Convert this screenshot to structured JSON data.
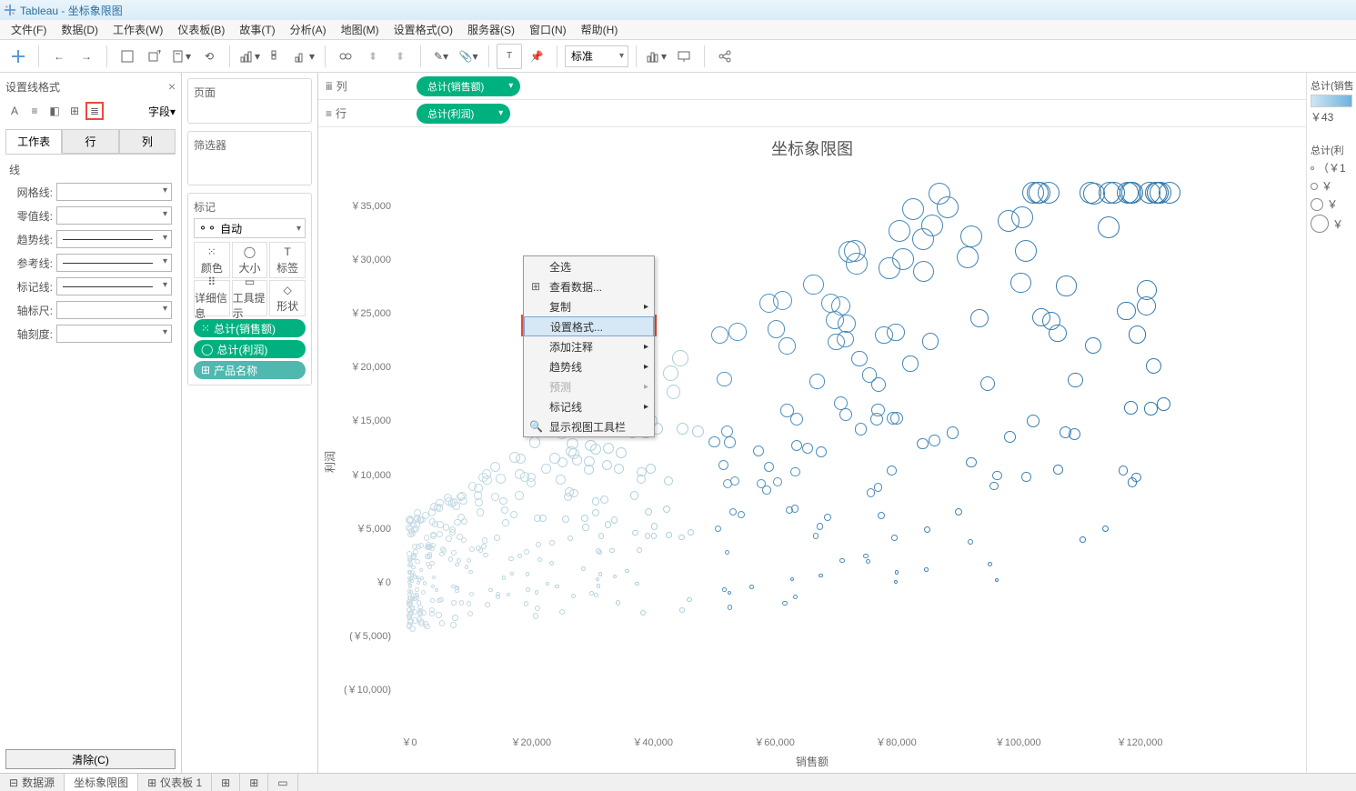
{
  "window_title": "Tableau - 坐标象限图",
  "menu": [
    "文件(F)",
    "数据(D)",
    "工作表(W)",
    "仪表板(B)",
    "故事(T)",
    "分析(A)",
    "地图(M)",
    "设置格式(O)",
    "服务器(S)",
    "窗口(N)",
    "帮助(H)"
  ],
  "toolbar_fit": "标准",
  "format_pane": {
    "title": "设置线格式",
    "fields_label": "字段",
    "tabs": [
      "工作表",
      "行",
      "列"
    ],
    "active_tab": 0,
    "section_label": "线",
    "rows": {
      "grid": "网格线:",
      "zero": "零值线:",
      "trend": "趋势线:",
      "ref": "参考线:",
      "drop": "标记线:",
      "axis_rule": "轴标尺:",
      "axis_tick": "轴刻度:"
    },
    "clear": "清除(C)"
  },
  "cards": {
    "pages": "页面",
    "filters": "筛选器",
    "marks": "标记",
    "marks_type": "自动",
    "mark_buttons": {
      "color": "颜色",
      "size": "大小",
      "label": "标签",
      "detail": "详细信息",
      "tooltip": "工具提示",
      "shape": "形状"
    },
    "mark_pills": {
      "sales": "总计(销售额)",
      "profit": "总计(利润)",
      "product": "产品名称"
    }
  },
  "shelves": {
    "columns_label": "列",
    "rows_label": "行",
    "col_pill": "总计(销售额)",
    "row_pill": "总计(利润)"
  },
  "viz": {
    "title": "坐标象限图",
    "ylabel": "利润",
    "xlabel": "销售额",
    "yticks": [
      "￥35,000",
      "￥30,000",
      "￥25,000",
      "￥20,000",
      "￥15,000",
      "￥10,000",
      "￥5,000",
      "￥0",
      "(￥5,000)",
      "(￥10,000)"
    ],
    "xticks": [
      "￥0",
      "￥20,000",
      "￥40,000",
      "￥60,000",
      "￥80,000",
      "￥100,000",
      "￥120,000"
    ]
  },
  "context_menu": {
    "items": [
      {
        "key": "select_all",
        "label": "全选",
        "icon": ""
      },
      {
        "key": "view_data",
        "label": "查看数据...",
        "icon": "⊞"
      },
      {
        "key": "copy",
        "label": "复制",
        "arrow": true,
        "icon": ""
      },
      {
        "key": "format",
        "label": "设置格式...",
        "hl": true
      },
      {
        "key": "annotate",
        "label": "添加注释",
        "arrow": true
      },
      {
        "key": "trend",
        "label": "趋势线",
        "arrow": true
      },
      {
        "key": "forecast",
        "label": "预测",
        "arrow": true,
        "disabled": true
      },
      {
        "key": "drop",
        "label": "标记线",
        "arrow": true
      },
      {
        "key": "showtoolbar",
        "label": "显示视图工具栏",
        "icon": "🔍"
      }
    ]
  },
  "legend": {
    "color_title": "总计(销售",
    "color_min": "￥43",
    "size_title": "总计(利",
    "size_sub": "（￥1",
    "size_vals": [
      "￥",
      "￥",
      "￥"
    ]
  },
  "bottom": {
    "datasource": "数据源",
    "sheet": "坐标象限图",
    "dashboard": "仪表板 1"
  },
  "chart_data": {
    "type": "scatter",
    "title": "坐标象限图",
    "xlabel": "销售额",
    "ylabel": "利润",
    "xlim": [
      0,
      130000
    ],
    "ylim": [
      -12000,
      37000
    ],
    "note": "Dense scatter of ~400 circles, size encoding 利润, color encoding 销售额 (light→dark blue). Heavy cluster near origin at low sales/profit, sparser large-sales outliers to the right.",
    "series": [
      {
        "name": "产品",
        "x": "销售额",
        "y": "利润",
        "size": "利润",
        "color": "销售额"
      }
    ]
  }
}
